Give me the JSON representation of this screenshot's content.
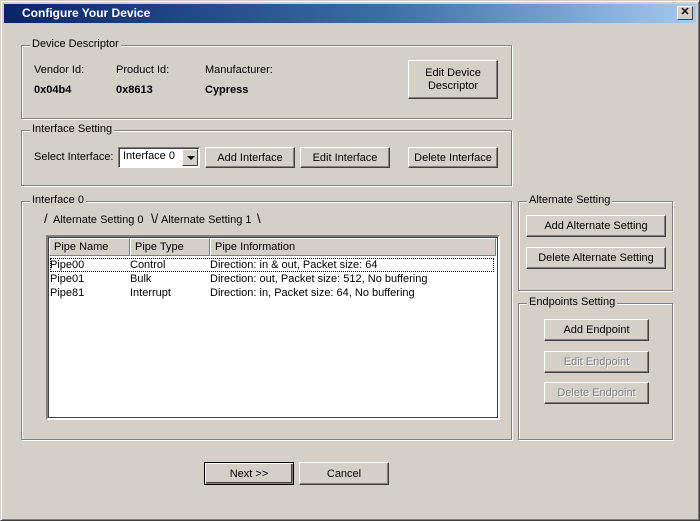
{
  "window": {
    "title": "Configure Your Device",
    "close_glyph": "✕"
  },
  "device_descriptor": {
    "group_title": "Device Descriptor",
    "vendor_label": "Vendor Id:",
    "vendor_value": "0x04b4",
    "product_label": "Product Id:",
    "product_value": "0x8613",
    "manufacturer_label": "Manufacturer:",
    "manufacturer_value": "Cypress",
    "edit_button_line1": "Edit Device",
    "edit_button_line2": "Descriptor"
  },
  "interface_setting": {
    "group_title": "Interface Setting",
    "select_label": "Select Interface:",
    "selected_value": "Interface 0",
    "add_button": "Add Interface",
    "edit_button": "Edit Interface",
    "delete_button": "Delete Interface"
  },
  "interface_group": {
    "group_title": "Interface 0",
    "tabs": [
      {
        "label": "Alternate Setting 0",
        "active": true
      },
      {
        "label": "Alternate Setting 1",
        "active": false
      }
    ],
    "columns": [
      "Pipe Name",
      "Pipe Type",
      "Pipe Information"
    ],
    "rows": [
      {
        "name": "Pipe00",
        "type": "Control",
        "info": "Direction: in & out, Packet size: 64"
      },
      {
        "name": "Pipe01",
        "type": "Bulk",
        "info": "Direction: out, Packet size: 512, No buffering"
      },
      {
        "name": "Pipe81",
        "type": "Interrupt",
        "info": "Direction: in, Packet size: 64, No buffering"
      }
    ]
  },
  "alternate_setting": {
    "group_title": "Alternate Setting",
    "add_button": "Add Alternate Setting",
    "delete_button": "Delete Alternate Setting"
  },
  "endpoints_setting": {
    "group_title": "Endpoints Setting",
    "add_button": "Add Endpoint",
    "edit_button": "Edit Endpoint",
    "delete_button": "Delete Endpoint"
  },
  "footer": {
    "next_button": "Next >>",
    "cancel_button": "Cancel"
  }
}
